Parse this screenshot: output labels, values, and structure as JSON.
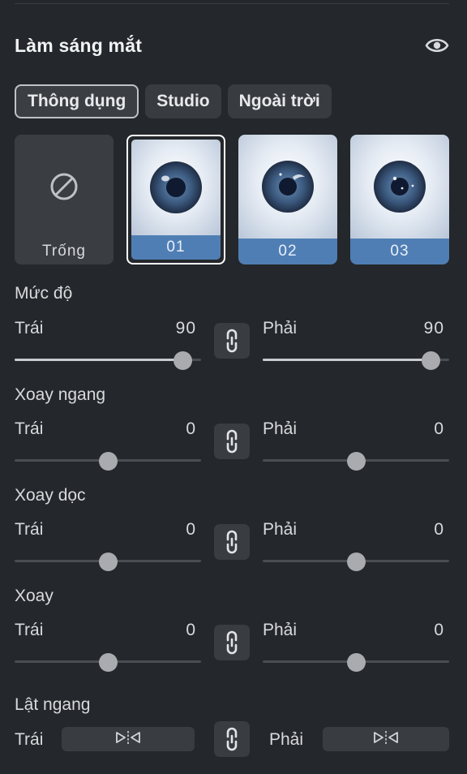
{
  "panel": {
    "title": "Làm sáng mắt",
    "visibility_icon": "eye-icon"
  },
  "tabs": [
    {
      "label": "Thông dụng",
      "active": true
    },
    {
      "label": "Studio",
      "active": false
    },
    {
      "label": "Ngoài trời",
      "active": false
    }
  ],
  "presets": [
    {
      "label": "Trống",
      "icon": "none-icon",
      "selected": false
    },
    {
      "label": "01",
      "icon": "eye-preset-thumbnail",
      "selected": true
    },
    {
      "label": "02",
      "icon": "eye-preset-thumbnail",
      "selected": false
    },
    {
      "label": "03",
      "icon": "eye-preset-thumbnail",
      "selected": false
    }
  ],
  "controls": [
    {
      "title": "Mức độ",
      "left_label": "Trái",
      "left_value": "90",
      "right_label": "Phải",
      "right_value": "90",
      "left_fraction": 0.9,
      "right_fraction": 0.9
    },
    {
      "title": "Xoay ngang",
      "left_label": "Trái",
      "left_value": "0",
      "right_label": "Phải",
      "right_value": "0",
      "left_fraction": 0.5,
      "right_fraction": 0.5
    },
    {
      "title": "Xoay dọc",
      "left_label": "Trái",
      "left_value": "0",
      "right_label": "Phải",
      "right_value": "0",
      "left_fraction": 0.5,
      "right_fraction": 0.5
    },
    {
      "title": "Xoay",
      "left_label": "Trái",
      "left_value": "0",
      "right_label": "Phải",
      "right_value": "0",
      "left_fraction": 0.5,
      "right_fraction": 0.5
    }
  ],
  "flip": {
    "title": "Lật ngang",
    "left_label": "Trái",
    "right_label": "Phải",
    "icon": "flip-horizontal-icon"
  },
  "link_icon": "link-icon",
  "colors": {
    "background": "#24272b",
    "accent": "#4f7eb4",
    "slider_knob": "#a9abae"
  }
}
